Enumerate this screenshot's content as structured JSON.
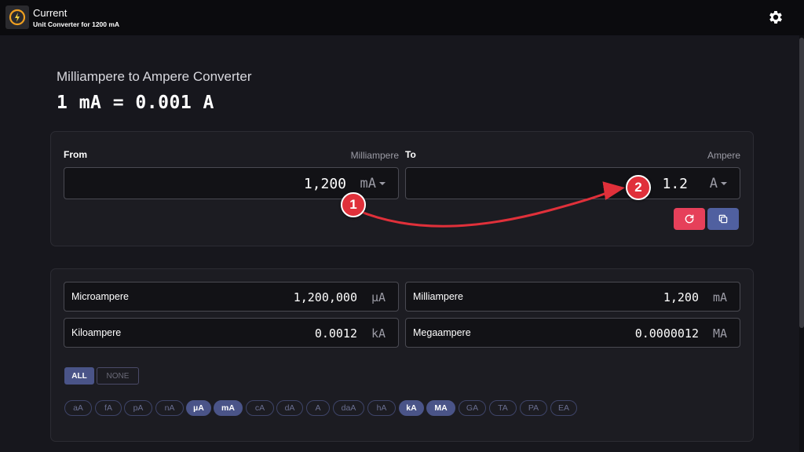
{
  "app": {
    "title": "Current",
    "subtitle": "Unit Converter for 1200 mA"
  },
  "converter": {
    "heading": "Milliampere to Ampere Converter",
    "formula": "1 mA = 0.001 A",
    "from": {
      "label": "From",
      "unit_name": "Milliampere",
      "value": "1,200",
      "unit": "mA"
    },
    "to": {
      "label": "To",
      "unit_name": "Ampere",
      "value": "1.2",
      "unit": "A"
    }
  },
  "results": [
    {
      "name": "Microampere",
      "value": "1,200,000",
      "unit": "µA"
    },
    {
      "name": "Milliampere",
      "value": "1,200",
      "unit": "mA"
    },
    {
      "name": "Kiloampere",
      "value": "0.0012",
      "unit": "kA"
    },
    {
      "name": "Megaampere",
      "value": "0.0000012",
      "unit": "MA"
    }
  ],
  "filters": {
    "all_label": "ALL",
    "none_label": "NONE"
  },
  "unit_chips": [
    {
      "label": "aA",
      "selected": false
    },
    {
      "label": "fA",
      "selected": false
    },
    {
      "label": "pA",
      "selected": false
    },
    {
      "label": "nA",
      "selected": false
    },
    {
      "label": "µA",
      "selected": true
    },
    {
      "label": "mA",
      "selected": true
    },
    {
      "label": "cA",
      "selected": false
    },
    {
      "label": "dA",
      "selected": false
    },
    {
      "label": "A",
      "selected": false
    },
    {
      "label": "daA",
      "selected": false
    },
    {
      "label": "hA",
      "selected": false
    },
    {
      "label": "kA",
      "selected": true
    },
    {
      "label": "MA",
      "selected": true
    },
    {
      "label": "GA",
      "selected": false
    },
    {
      "label": "TA",
      "selected": false
    },
    {
      "label": "PA",
      "selected": false
    },
    {
      "label": "EA",
      "selected": false
    }
  ],
  "annotations": [
    {
      "label": "1"
    },
    {
      "label": "2"
    }
  ],
  "colors": {
    "accent": "#4a5488",
    "reset_button": "#e6405a",
    "copy_button": "#5060a0",
    "annotation": "#e0303a",
    "background": "#17171d"
  },
  "icons": {
    "logo": "clock-bolt-icon",
    "settings": "gear-icon",
    "reset": "refresh-icon",
    "copy": "copy-icon"
  }
}
